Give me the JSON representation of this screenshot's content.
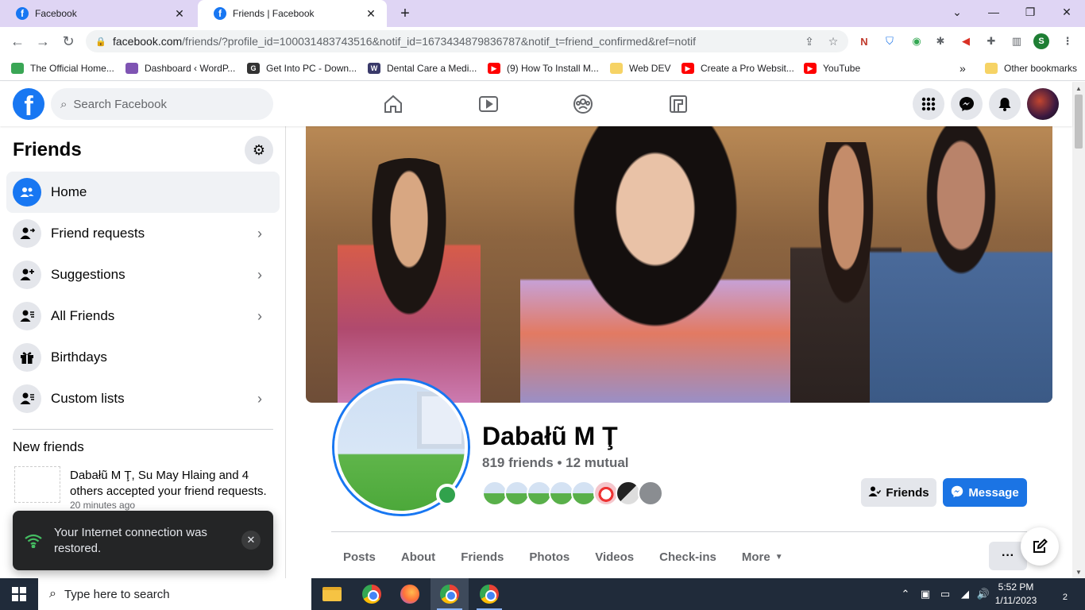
{
  "browser": {
    "tabs": [
      {
        "title": "Facebook",
        "active": false
      },
      {
        "title": "Friends | Facebook",
        "active": true
      }
    ],
    "url_main": "facebook.com",
    "url_rest": "/friends/?profile_id=100031483743516&notif_id=1673434879836787&notif_t=friend_confirmed&ref=notif",
    "bookmarks": [
      {
        "label": "The Official Home...",
        "color": "#3aa655"
      },
      {
        "label": "Dashboard ‹ WordP...",
        "color": "#7f54b3"
      },
      {
        "label": "Get Into PC - Down...",
        "color": "#333333"
      },
      {
        "label": "Dental Care a Medi...",
        "color": "#3a3a6a"
      },
      {
        "label": "(9) How To Install M...",
        "color": "#ff0000"
      },
      {
        "label": "Web DEV",
        "color": "#f6d365"
      },
      {
        "label": "Create a Pro Websit...",
        "color": "#ff0000"
      },
      {
        "label": "YouTube",
        "color": "#ff0000"
      }
    ],
    "bookmarks_more": "»",
    "other_bookmarks": "Other bookmarks",
    "profile_initial": "S"
  },
  "header": {
    "logo": "f",
    "search_placeholder": "Search Facebook"
  },
  "sidebar": {
    "title": "Friends",
    "items": [
      {
        "label": "Home",
        "icon": "friends-icon",
        "active": true,
        "chevron": false
      },
      {
        "label": "Friend requests",
        "icon": "friend-request-icon",
        "active": false,
        "chevron": true
      },
      {
        "label": "Suggestions",
        "icon": "add-friend-icon",
        "active": false,
        "chevron": true
      },
      {
        "label": "All Friends",
        "icon": "friend-list-icon",
        "active": false,
        "chevron": true
      },
      {
        "label": "Birthdays",
        "icon": "gift-icon",
        "active": false,
        "chevron": false
      },
      {
        "label": "Custom lists",
        "icon": "custom-list-icon",
        "active": false,
        "chevron": true
      }
    ],
    "new_friends_title": "New friends",
    "notification": {
      "names": "Dabałũ M Ţ, Su May Hlaing",
      "rest": " and 4 others accepted your friend requests.",
      "time": "20 minutes ago"
    }
  },
  "toast": {
    "text": "Your Internet connection was restored."
  },
  "profile": {
    "name": "Dabałũ M Ţ",
    "friends_count": "819 friends • 12 mutual",
    "friends_button": "Friends",
    "message_button": "Message",
    "tabs": [
      "Posts",
      "About",
      "Friends",
      "Photos",
      "Videos",
      "Check-ins",
      "More"
    ],
    "more_dots": "···"
  },
  "taskbar": {
    "search_placeholder": "Type here to search",
    "time": "5:52 PM",
    "date": "1/11/2023",
    "notification_count": "2"
  }
}
